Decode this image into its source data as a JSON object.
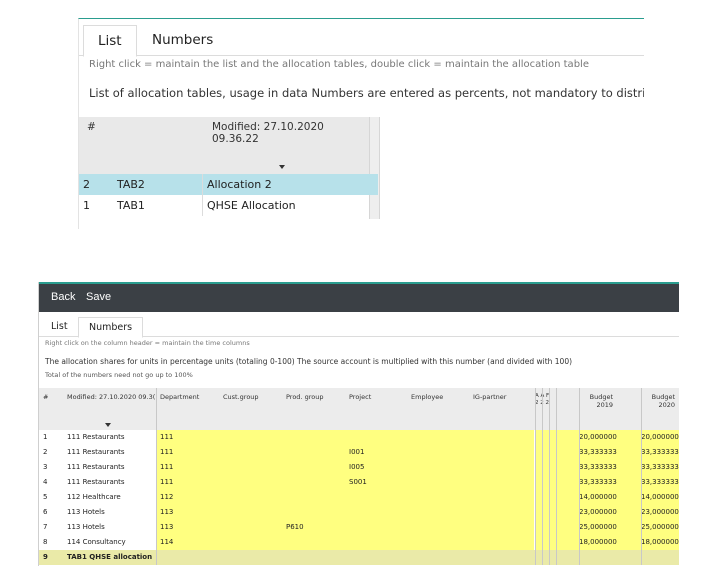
{
  "panel1": {
    "tabs": [
      "List",
      "Numbers"
    ],
    "hint": "Right click = maintain the list and the allocation tables, double click = maintain the allocation table",
    "description": "List of allocation tables, usage in data Numbers are entered as percents, not mandatory to distribute all",
    "header": {
      "num": "#",
      "modified": "Modified: 27.10.2020 09.36.22"
    },
    "rows": [
      {
        "num": "2",
        "code": "TAB2",
        "name": "Allocation 2",
        "selected": true
      },
      {
        "num": "1",
        "code": "TAB1",
        "name": "QHSE Allocation",
        "selected": false
      }
    ],
    "colors": {
      "accent": "#2a9d8f",
      "selected_row": "#b7e1ea"
    }
  },
  "panel2": {
    "toolbar": {
      "back": "Back",
      "save": "Save"
    },
    "tabs": [
      "List",
      "Numbers"
    ],
    "hint": "Right click on the column header = maintain the time columns",
    "description": "The allocation shares for units in percentage units (totaling 0-100) The source account is multiplied with this number (and divided with 100)",
    "note": "Total of the numbers need not go up to 100%",
    "headers": {
      "num": "#",
      "modified": "Modified: 27.10.2020 09.3(",
      "department": "Department",
      "cust_group": "Cust.group",
      "prod_group": "Prod. group",
      "project": "Project",
      "employee": "Employee",
      "ig_partner": "IG-partner",
      "narrow": [
        "A A F",
        "2 2 2"
      ],
      "budget2019": [
        "Budget",
        "2019"
      ],
      "budget2020": [
        "Budget",
        "2020"
      ]
    },
    "rows": [
      {
        "num": "1",
        "unit": "111 Restaurants",
        "dept": "111",
        "prod": "",
        "project": "",
        "b2019": "20,000000",
        "b2020": "20,000000"
      },
      {
        "num": "2",
        "unit": "111 Restaurants",
        "dept": "111",
        "prod": "",
        "project": "I001",
        "b2019": "33,333333",
        "b2020": "33,333333"
      },
      {
        "num": "3",
        "unit": "111 Restaurants",
        "dept": "111",
        "prod": "",
        "project": "I005",
        "b2019": "33,333333",
        "b2020": "33,333333"
      },
      {
        "num": "4",
        "unit": "111 Restaurants",
        "dept": "111",
        "prod": "",
        "project": "S001",
        "b2019": "33,333333",
        "b2020": "33,333333"
      },
      {
        "num": "5",
        "unit": "112 Healthcare",
        "dept": "112",
        "prod": "",
        "project": "",
        "b2019": "14,000000",
        "b2020": "14,000000"
      },
      {
        "num": "6",
        "unit": "113 Hotels",
        "dept": "113",
        "prod": "",
        "project": "",
        "b2019": "23,000000",
        "b2020": "23,000000"
      },
      {
        "num": "7",
        "unit": "113 Hotels",
        "dept": "113",
        "prod": "P610",
        "project": "",
        "b2019": "25,000000",
        "b2020": "25,000000"
      },
      {
        "num": "8",
        "unit": "114 Consultancy",
        "dept": "114",
        "prod": "",
        "project": "",
        "b2019": "18,000000",
        "b2020": "18,000000"
      }
    ],
    "summary": {
      "num": "9",
      "label": "TAB1 QHSE allocation"
    },
    "colors": {
      "toolbar": "#3b4045",
      "accent": "#2a9d8f",
      "cell_highlight": "#ffff80",
      "summary_row": "#eaeaa8"
    }
  }
}
